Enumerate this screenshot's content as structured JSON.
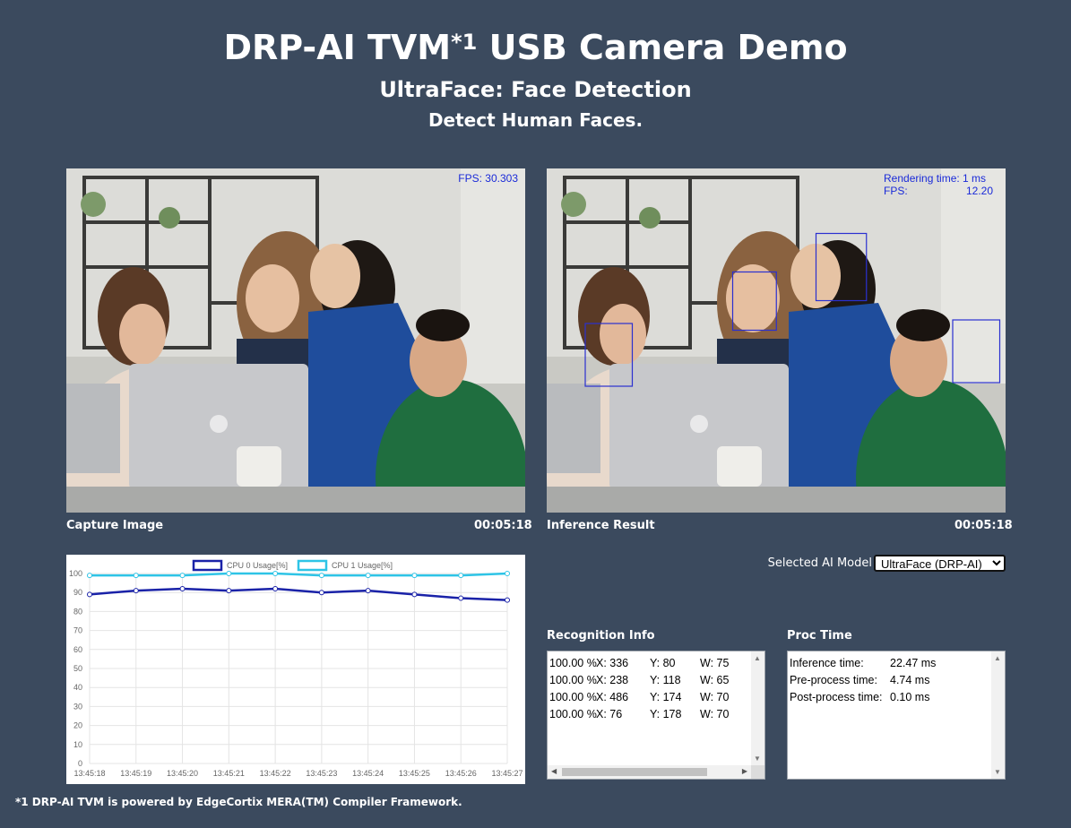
{
  "header": {
    "title": "DRP-AI TVM",
    "title_sup": "*1",
    "title_rest": " USB Camera Demo",
    "subtitle": "UltraFace: Face Detection",
    "description": "Detect Human Faces."
  },
  "capture": {
    "fps_label": "FPS: 30.303",
    "caption": "Capture Image",
    "time": "00:05:18"
  },
  "inference": {
    "rendering_label": "Rendering time: 1 ms",
    "fps_key": "FPS:",
    "fps_value": "12.20",
    "caption": "Inference Result",
    "time": "00:05:18"
  },
  "model_select": {
    "label": "Selected AI Model",
    "selected": "UltraFace (DRP-AI)"
  },
  "recognition": {
    "title": "Recognition Info",
    "rows": [
      {
        "score": "100.00 %",
        "x": "X: 336",
        "y": "Y: 80",
        "w": "W: 75"
      },
      {
        "score": "100.00 %",
        "x": "X: 238",
        "y": "Y: 118",
        "w": "W: 65"
      },
      {
        "score": "100.00 %",
        "x": "X: 486",
        "y": "Y: 174",
        "w": "W: 70"
      },
      {
        "score": "100.00 %",
        "x": "X: 76",
        "y": "Y: 178",
        "w": "W: 70"
      }
    ]
  },
  "proc_time": {
    "title": "Proc Time",
    "rows": [
      {
        "label": "Inference time:",
        "value": "22.47 ms"
      },
      {
        "label": "Pre-process time:",
        "value": "4.74 ms"
      },
      {
        "label": "Post-process time:",
        "value": "0.10 ms"
      }
    ]
  },
  "footer": {
    "note": "*1 DRP-AI TVM is powered by EdgeCortix MERA(TM) Compiler Framework."
  },
  "colors": {
    "background": "#3b4a5e",
    "cpu0": "#1a22a8",
    "cpu1": "#2ec4e6",
    "bbox": "#2a30d0"
  },
  "chart_data": {
    "type": "line",
    "x": [
      "13:45:18",
      "13:45:19",
      "13:45:20",
      "13:45:21",
      "13:45:22",
      "13:45:23",
      "13:45:24",
      "13:45:25",
      "13:45:26",
      "13:45:27"
    ],
    "series": [
      {
        "name": "CPU 0 Usage[%]",
        "values": [
          89,
          91,
          92,
          91,
          92,
          90,
          91,
          89,
          87,
          86
        ]
      },
      {
        "name": "CPU 1 Usage[%]",
        "values": [
          99,
          99,
          99,
          100,
          100,
          99,
          99,
          99,
          99,
          100
        ]
      }
    ],
    "yticks": [
      "0",
      "10",
      "20",
      "30",
      "40",
      "50",
      "60",
      "70",
      "80",
      "90",
      "100"
    ],
    "ylim": [
      0,
      100
    ],
    "grid": true,
    "legend": "top"
  }
}
